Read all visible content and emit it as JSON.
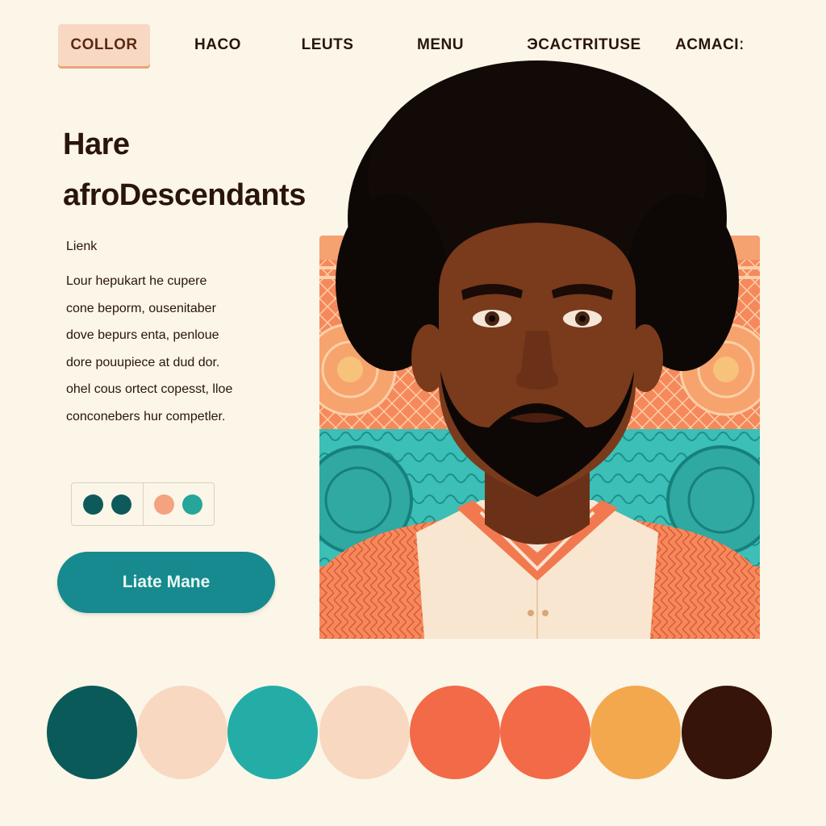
{
  "nav": {
    "items": [
      "COLLOR",
      "HACO",
      "LEUTS",
      "MENU",
      "ЭCACTRITUSE",
      "ACMACIː"
    ],
    "active_index": 0
  },
  "hero": {
    "headline_line1": "Hare",
    "headline_line2": "afroDescendants",
    "link_label": "Lienk",
    "body_lines": [
      "Lour hepukart he cupere",
      "cone beporm, ousenitaber",
      "dove bepurs enta, penloue",
      "dore pouupiece at dud dor.",
      "ohel cous ortect copesst, lloe",
      "conconebers hur competler."
    ],
    "cta_label": "Liate Mane"
  },
  "toggle": {
    "left_colors": [
      "#0e5a5a",
      "#0e5a5a"
    ],
    "right_colors": [
      "#f5a27e",
      "#26a69a"
    ]
  },
  "palette": {
    "colors": [
      "#0b5a5a",
      "#f8d8c0",
      "#24ada6",
      "#f8d8c0",
      "#f26a48",
      "#f36a48",
      "#f3a84e",
      "#371409"
    ]
  },
  "illustration": {
    "skin": "#7a3a1c",
    "hair": "#0d0806",
    "shirt": "#f8e6d0",
    "pattern_orange": "#f6895c",
    "pattern_teal": "#3bbfb6",
    "pattern_yellow": "#f6b56a"
  }
}
